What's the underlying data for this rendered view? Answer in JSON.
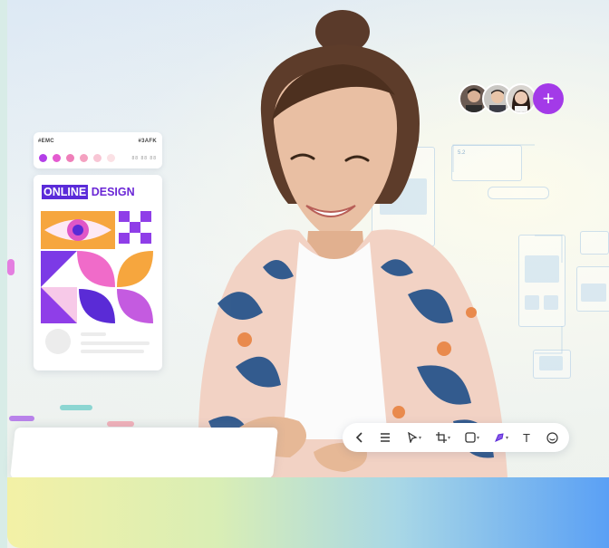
{
  "palette_card": {
    "header_left": "#EMC",
    "header_right": "#3AFK",
    "values_label": "88 88 88",
    "swatch_colors": [
      "#b33fe8",
      "#e45ad0",
      "#ef7fb9",
      "#f4a1c0",
      "#f8c6d5",
      "#fbe1e5"
    ]
  },
  "design_card": {
    "title_highlight": "ONLINE",
    "title_rest": " DESIGN"
  },
  "collaborators": {
    "add_label": "+"
  },
  "wireframes": {
    "card_label": "5.2"
  },
  "toolbar": {
    "tools": [
      "back",
      "menu",
      "select",
      "crop",
      "frame",
      "pen",
      "text",
      "settings"
    ],
    "text_tool_label": "T"
  },
  "colors": {
    "accent_purple": "#a33ae8",
    "title_purple": "#5b2bd9",
    "bottom_gradient_start": "#f3f1a6",
    "bottom_gradient_end": "#5aa0f5"
  }
}
